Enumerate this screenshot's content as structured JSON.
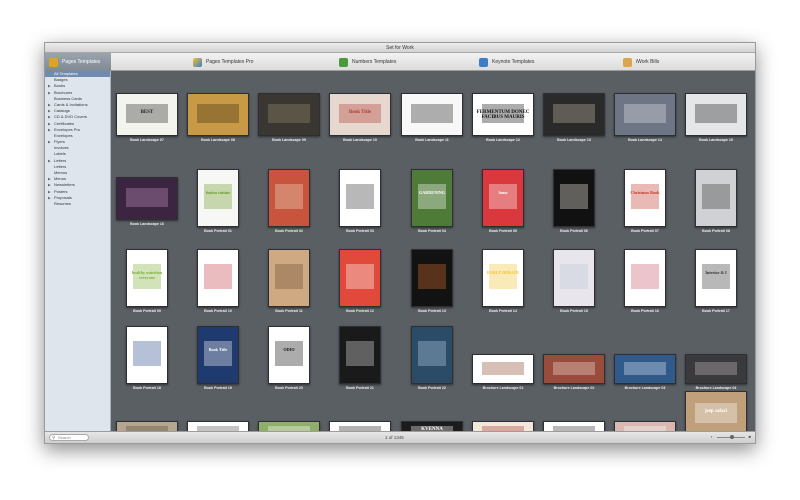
{
  "window": {
    "title": "Set for Work"
  },
  "tabs": [
    {
      "label": "Pages Templates",
      "color": "#e0a321"
    },
    {
      "label": "Pages Templates Pro",
      "color": "#f1c232"
    },
    {
      "label": "Numbers Templates",
      "color": "#4a9a3a"
    },
    {
      "label": "Keynote Templates",
      "color": "#3b7dc8"
    },
    {
      "label": "iWork Bills",
      "color": "#d9a64a"
    }
  ],
  "sidebar": {
    "items": [
      {
        "label": "All Templates",
        "selected": true,
        "group": false
      },
      {
        "label": "Badges",
        "group": false
      },
      {
        "label": "Books",
        "group": true
      },
      {
        "label": "Brochures",
        "group": true
      },
      {
        "label": "Business Cards",
        "group": false
      },
      {
        "label": "Cards & Invitations",
        "group": true
      },
      {
        "label": "Catalogs",
        "group": true
      },
      {
        "label": "CD & DVD Covers",
        "group": true
      },
      {
        "label": "Certificates",
        "group": true
      },
      {
        "label": "Envelopes Pro",
        "group": true
      },
      {
        "label": "Envelopes",
        "group": false
      },
      {
        "label": "Flyers",
        "group": true
      },
      {
        "label": "Invoices",
        "group": false
      },
      {
        "label": "Labels",
        "group": false
      },
      {
        "label": "Letters",
        "group": true
      },
      {
        "label": "Letters",
        "group": false
      },
      {
        "label": "Memos",
        "group": false
      },
      {
        "label": "Menus",
        "group": true
      },
      {
        "label": "Newsletters",
        "group": true
      },
      {
        "label": "Posters",
        "group": true
      },
      {
        "label": "Proposals",
        "group": true
      },
      {
        "label": "Resumes",
        "group": false
      }
    ]
  },
  "status": {
    "search_placeholder": "Search",
    "page_count": "1 of 1345",
    "zoom_level": 0.55
  },
  "thumbnails": [
    {
      "label": "Book Landscape 07",
      "bg": "#f4f4ef",
      "accent": "#222",
      "text": "BEST"
    },
    {
      "label": "Book Landscape 08",
      "bg": "#c89a46",
      "accent": "#3d2a14",
      "text": ""
    },
    {
      "label": "Book Landscape 09",
      "bg": "#3a3632",
      "accent": "#9a8f70",
      "text": ""
    },
    {
      "label": "Book Landscape 10",
      "bg": "#e7d8cf",
      "accent": "#b03a2e",
      "text": "Book Title"
    },
    {
      "label": "Book Landscape 11",
      "bg": "#f8f8f8",
      "accent": "#222",
      "text": ""
    },
    {
      "label": "Book Landscape 12",
      "bg": "#ffffff",
      "accent": "#111",
      "text": "FERMENTUM DONEC FACIBUS MAURIS"
    },
    {
      "label": "Book Landscape 13",
      "bg": "#2a2a2a",
      "accent": "#c9b8a6",
      "text": ""
    },
    {
      "label": "Book Landscape 14",
      "bg": "#6e7584",
      "accent": "#e6e6ee",
      "text": ""
    },
    {
      "label": "Book Landscape 15",
      "bg": "#e5e6e8",
      "accent": "#1a1a1a",
      "text": ""
    },
    {
      "label": "Book Landscape 16",
      "bg": "#3b2541",
      "accent": "#c591c4",
      "text": ""
    },
    {
      "label": "Book Portrait 01",
      "bg": "#f7f7f5",
      "accent": "#6a9a2b",
      "text": "fusion cuisine"
    },
    {
      "label": "Book Portrait 02",
      "bg": "#c8543d",
      "accent": "#f0e2c8",
      "text": ""
    },
    {
      "label": "Book Portrait 03",
      "bg": "#ffffff",
      "accent": "#333",
      "text": ""
    },
    {
      "label": "Book Portrait 04",
      "bg": "#4f7b39",
      "accent": "#ffffff",
      "text": "GARDENING"
    },
    {
      "label": "Book Portrait 05",
      "bg": "#d9383c",
      "accent": "#ffffff",
      "text": "lomo"
    },
    {
      "label": "Book Portrait 06",
      "bg": "#111111",
      "accent": "#f4f0e8",
      "text": ""
    },
    {
      "label": "Book Portrait 07",
      "bg": "#ffffff",
      "accent": "#c0392b",
      "text": "Christmas Book"
    },
    {
      "label": "Book Portrait 08",
      "bg": "#cfd1d4",
      "accent": "#333",
      "text": ""
    },
    {
      "label": "Book Portrait 09",
      "bg": "#ffffff",
      "accent": "#7fae3a",
      "text": "healthy nutrition everyone"
    },
    {
      "label": "Book Portrait 10",
      "bg": "#ffffff",
      "accent": "#c43c49",
      "text": ""
    },
    {
      "label": "Book Portrait 11",
      "bg": "#cfa981",
      "accent": "#6a4a33",
      "text": ""
    },
    {
      "label": "Book Portrait 12",
      "bg": "#e14a3b",
      "accent": "#ffffff",
      "text": ""
    },
    {
      "label": "Book Portrait 13",
      "bg": "#121212",
      "accent": "#e07030",
      "text": ""
    },
    {
      "label": "Book Portrait 14",
      "bg": "#ffffff",
      "accent": "#f1c232",
      "text": "EARLY DEBATE"
    },
    {
      "label": "Book Portrait 15",
      "bg": "#e8e6ec",
      "accent": "#b9c5d8",
      "text": ""
    },
    {
      "label": "Book Portrait 16",
      "bg": "#ffffff",
      "accent": "#c9556b",
      "text": ""
    },
    {
      "label": "Book Portrait 17",
      "bg": "#ffffff",
      "accent": "#333",
      "text": "Interior & I"
    },
    {
      "label": "Book Portrait 18",
      "bg": "#ffffff",
      "accent": "#2e4a8a",
      "text": ""
    },
    {
      "label": "Book Portrait 19",
      "bg": "#1f3a6e",
      "accent": "#ffffff",
      "text": "Book Title"
    },
    {
      "label": "Book Portrait 20",
      "bg": "#ffffff",
      "accent": "#111",
      "text": "ODIO"
    },
    {
      "label": "Book Portrait 21",
      "bg": "#1a1a1a",
      "accent": "#e6e6e6",
      "text": ""
    },
    {
      "label": "Book Portrait 22",
      "bg": "#2c4b66",
      "accent": "#b8d4ea",
      "text": ""
    },
    {
      "label": "Brochure Landscape 01",
      "bg": "#ffffff",
      "accent": "#8a4a2a",
      "text": ""
    },
    {
      "label": "Brochure Landscape 02",
      "bg": "#9a4c3c",
      "accent": "#f0e2d8",
      "text": ""
    },
    {
      "label": "Brochure Landscape 03",
      "bg": "#2f5a8a",
      "accent": "#e0e8f0",
      "text": ""
    },
    {
      "label": "Brochure Landscape 04",
      "bg": "#3a3a3c",
      "accent": "#c9bfc4",
      "text": ""
    },
    {
      "label": "",
      "bg": "#b5a68f",
      "accent": "#5a4a3a",
      "text": ""
    },
    {
      "label": "",
      "bg": "#ffffff",
      "accent": "#555",
      "text": ""
    },
    {
      "label": "",
      "bg": "#8fae6a",
      "accent": "#fff",
      "text": ""
    },
    {
      "label": "",
      "bg": "#ffffff",
      "accent": "#222",
      "text": ""
    },
    {
      "label": "",
      "bg": "#1c1c1c",
      "accent": "#ffffff",
      "text": "KVENNA"
    },
    {
      "label": "",
      "bg": "#f1e8d8",
      "accent": "#a33",
      "text": ""
    },
    {
      "label": "",
      "bg": "#ffffff",
      "accent": "#333",
      "text": ""
    },
    {
      "label": "",
      "bg": "#d8b8b0",
      "accent": "#fff",
      "text": ""
    },
    {
      "label": "",
      "bg": "#bfa07a",
      "accent": "#ffffff",
      "text": "jeep safari"
    }
  ]
}
